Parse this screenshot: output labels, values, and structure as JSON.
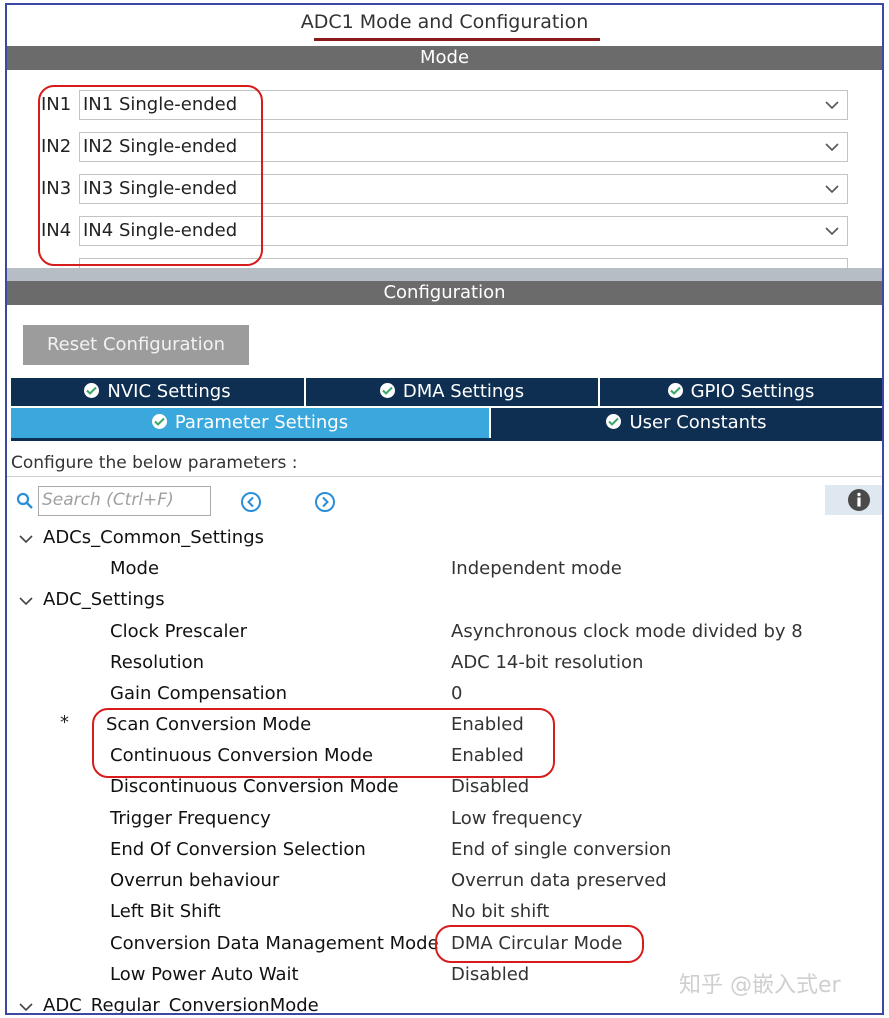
{
  "header": {
    "title": "ADC1 Mode and Configuration"
  },
  "mode": {
    "bar_label": "Mode",
    "rows": [
      {
        "label": "IN1",
        "value": "IN1 Single-ended"
      },
      {
        "label": "IN2",
        "value": "IN2 Single-ended"
      },
      {
        "label": "IN3",
        "value": "IN3 Single-ended"
      },
      {
        "label": "IN4",
        "value": "IN4 Single-ended"
      }
    ]
  },
  "configuration": {
    "bar_label": "Configuration",
    "reset_label": "Reset Configuration",
    "tabs_row1": [
      "NVIC Settings",
      "DMA Settings",
      "GPIO Settings"
    ],
    "tabs_row2": [
      "Parameter Settings",
      "User Constants"
    ],
    "active_tab": "Parameter Settings",
    "configure_text": "Configure the below parameters :",
    "search_placeholder": "Search (Ctrl+F)"
  },
  "params": {
    "common_section": "ADCs_Common_Settings",
    "common": [
      {
        "label": "Mode",
        "value": "Independent mode"
      }
    ],
    "adc_section": "ADC_Settings",
    "adc": [
      {
        "label": "Clock Prescaler",
        "value": "Asynchronous clock mode divided by 8"
      },
      {
        "label": "Resolution",
        "value": "ADC 14-bit resolution"
      },
      {
        "label": "Gain Compensation",
        "value": "0"
      },
      {
        "label": "Scan Conversion Mode",
        "value": "Enabled",
        "marker": "*"
      },
      {
        "label": "Continuous Conversion Mode",
        "value": "Enabled"
      },
      {
        "label": "Discontinuous Conversion Mode",
        "value": "Disabled"
      },
      {
        "label": "Trigger Frequency",
        "value": "Low frequency"
      },
      {
        "label": "End Of Conversion Selection",
        "value": "End of single conversion"
      },
      {
        "label": "Overrun behaviour",
        "value": "Overrun data preserved"
      },
      {
        "label": "Left Bit Shift",
        "value": "No bit shift"
      },
      {
        "label": "Conversion Data Management Mode",
        "value": "DMA Circular Mode"
      },
      {
        "label": "Low Power Auto Wait",
        "value": "Disabled"
      }
    ],
    "regular_section": "ADC_Regular_ConversionMode"
  },
  "watermark": "知乎 @嵌入式er",
  "colors": {
    "bar": "#6b6b6b",
    "tab_dark": "#0e2f52",
    "tab_active": "#3aa8dc",
    "annotation": "#d81b1b",
    "frame": "#3c49a4"
  }
}
